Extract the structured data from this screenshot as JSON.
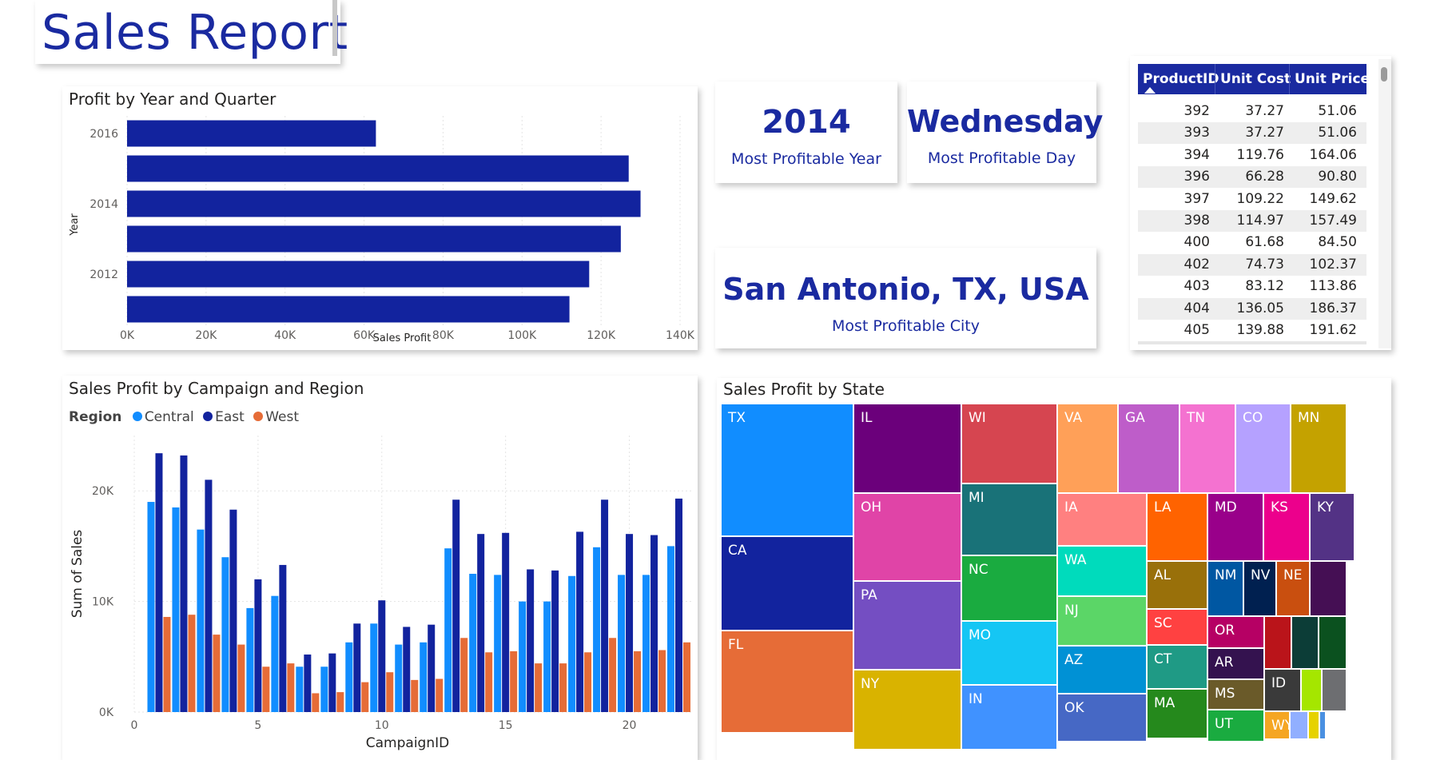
{
  "report": {
    "title": "Sales Report"
  },
  "bar_chart": {
    "title": "Profit by Year and Quarter"
  },
  "kpis": [
    {
      "value": "2014",
      "label": "Most Profitable Year"
    },
    {
      "value": "Wednesday",
      "label": "Most Profitable Day"
    },
    {
      "value": "San Antonio, TX, USA",
      "label": "Most Profitable City"
    }
  ],
  "product_table": {
    "headers": [
      "ProductID",
      "Unit Cost",
      "Unit Price"
    ],
    "sort_icon": "sort-ascending-icon",
    "rows": [
      [
        "392",
        "37.27",
        "51.06"
      ],
      [
        "393",
        "37.27",
        "51.06"
      ],
      [
        "394",
        "119.76",
        "164.06"
      ],
      [
        "396",
        "66.28",
        "90.80"
      ],
      [
        "397",
        "109.22",
        "149.62"
      ],
      [
        "398",
        "114.97",
        "157.49"
      ],
      [
        "400",
        "61.68",
        "84.50"
      ],
      [
        "402",
        "74.73",
        "102.37"
      ],
      [
        "403",
        "83.12",
        "113.86"
      ],
      [
        "404",
        "136.05",
        "186.37"
      ],
      [
        "405",
        "139.88",
        "191.62"
      ]
    ]
  },
  "campaign_chart": {
    "title": "Sales Profit by Campaign and Region",
    "legend_title": "Region"
  },
  "treemap": {
    "title": "Sales Profit by State",
    "cells": [
      {
        "label": "TX",
        "color": "#118DFF"
      },
      {
        "label": "CA",
        "color": "#12239E"
      },
      {
        "label": "FL",
        "color": "#E66C37"
      },
      {
        "label": "IL",
        "color": "#6B007B"
      },
      {
        "label": "OH",
        "color": "#E044A7"
      },
      {
        "label": "PA",
        "color": "#744EC2"
      },
      {
        "label": "NY",
        "color": "#D9B300"
      },
      {
        "label": "WI",
        "color": "#D64550"
      },
      {
        "label": "MI",
        "color": "#197278"
      },
      {
        "label": "NC",
        "color": "#1AAB40"
      },
      {
        "label": "MO",
        "color": "#15C6F4"
      },
      {
        "label": "IN",
        "color": "#4092FF"
      },
      {
        "label": "VA",
        "color": "#FFA058"
      },
      {
        "label": "GA",
        "color": "#BE5DC9"
      },
      {
        "label": "TN",
        "color": "#F472D0"
      },
      {
        "label": "CO",
        "color": "#B5A1FF"
      },
      {
        "label": "MN",
        "color": "#C4A200"
      },
      {
        "label": "IA",
        "color": "#FF8080"
      },
      {
        "label": "WA",
        "color": "#00DBBC"
      },
      {
        "label": "NJ",
        "color": "#5BD667"
      },
      {
        "label": "AZ",
        "color": "#0091D5"
      },
      {
        "label": "OK",
        "color": "#4668C5"
      },
      {
        "label": "LA",
        "color": "#FF6300"
      },
      {
        "label": "MD",
        "color": "#99008A"
      },
      {
        "label": "KS",
        "color": "#EC008C"
      },
      {
        "label": "KY",
        "color": "#533285"
      },
      {
        "label": "AL",
        "color": "#99700A"
      },
      {
        "label": "SC",
        "color": "#FF4141"
      },
      {
        "label": "CT",
        "color": "#1F9A85"
      },
      {
        "label": "MA",
        "color": "#25891C"
      },
      {
        "label": "NM",
        "color": "#0057A2"
      },
      {
        "label": "NV",
        "color": "#002050"
      },
      {
        "label": "NE",
        "color": "#C94F0F"
      },
      {
        "label": "",
        "color": "#450F54"
      },
      {
        "label": "OR",
        "color": "#B60064"
      },
      {
        "label": "AR",
        "color": "#34124F"
      },
      {
        "label": "MS",
        "color": "#6A5A29"
      },
      {
        "label": "UT",
        "color": "#1AAB40"
      },
      {
        "label": "",
        "color": "#BA141A"
      },
      {
        "label": "",
        "color": "#0C3D37"
      },
      {
        "label": "",
        "color": "#0B511F"
      },
      {
        "label": "ID",
        "color": "#3A3A3A"
      },
      {
        "label": "",
        "color": "#A5E600"
      },
      {
        "label": "",
        "color": "#6D6E71"
      },
      {
        "label": "WY",
        "color": "#F5A623"
      },
      {
        "label": "",
        "color": "#91AFFF"
      },
      {
        "label": "",
        "color": "#E6D200"
      },
      {
        "label": "",
        "color": "#4A90E2"
      }
    ]
  },
  "chart_data": [
    {
      "type": "bar",
      "orientation": "horizontal",
      "title": "Profit by Year and Quarter",
      "xlabel": "Sales Profit",
      "ylabel": "Year",
      "categories": [
        "2016",
        "",
        "2014",
        "",
        "2012",
        ""
      ],
      "values": [
        63000,
        127000,
        130000,
        125000,
        117000,
        112000
      ],
      "xticks": [
        "0K",
        "20K",
        "40K",
        "60K",
        "80K",
        "100K",
        "120K",
        "140K"
      ],
      "xlim": [
        0,
        140000
      ],
      "color": "#12239E",
      "grid": true
    },
    {
      "type": "bar",
      "title": "Sales Profit by Campaign and Region",
      "xlabel": "CampaignID",
      "ylabel": "Sum of Sales",
      "legend_position": "top-left",
      "x": [
        1,
        2,
        3,
        4,
        5,
        6,
        7,
        8,
        9,
        10,
        11,
        12,
        13,
        14,
        15,
        16,
        17,
        18,
        19,
        20,
        21,
        22
      ],
      "xticks": [
        "0",
        "5",
        "10",
        "15",
        "20"
      ],
      "xlim": [
        0,
        22.5
      ],
      "yticks": [
        "0K",
        "10K",
        "20K"
      ],
      "ylim": [
        0,
        25000
      ],
      "grid": true,
      "series": [
        {
          "name": "Central",
          "color": "#118DFF",
          "values": [
            19000,
            18500,
            16500,
            14000,
            9400,
            10500,
            4100,
            4100,
            6300,
            8000,
            6100,
            6300,
            14800,
            12500,
            12400,
            10000,
            10000,
            12300,
            14900,
            12400,
            12400,
            15000
          ]
        },
        {
          "name": "East",
          "color": "#12239E",
          "values": [
            23400,
            23200,
            21000,
            18300,
            12000,
            13300,
            5200,
            5300,
            8000,
            10100,
            7700,
            7900,
            19200,
            16100,
            16200,
            12900,
            12800,
            16300,
            19200,
            16100,
            16000,
            19300
          ]
        },
        {
          "name": "West",
          "color": "#E66C37",
          "values": [
            8600,
            8800,
            7000,
            6100,
            4100,
            4400,
            1700,
            1800,
            2700,
            3600,
            2900,
            3000,
            6700,
            5400,
            5500,
            4400,
            4400,
            5400,
            6700,
            5500,
            5600,
            6300
          ]
        }
      ]
    }
  ]
}
